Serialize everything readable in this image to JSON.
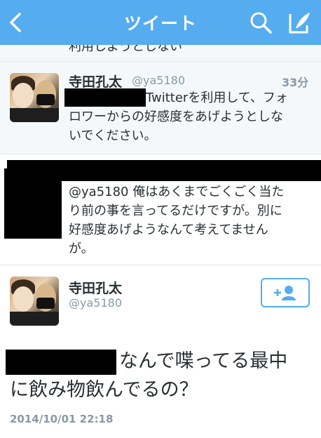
{
  "nav": {
    "title": "ツイート",
    "back_icon": "chevron-left-icon",
    "search_icon": "search-icon",
    "compose_icon": "compose-icon",
    "color": "#55acee"
  },
  "cut_tweet": {
    "text": "利用しようとしない"
  },
  "tweet1": {
    "name": "寺田孔太",
    "handle": "@ya5180",
    "time": "33分",
    "line1": "Twitterを利用して、フォ",
    "line2": "ロワーからの好感度をあげようとしな",
    "line3": "いでください。"
  },
  "tweet2": {
    "line1": "@ya5180 俺はあくまでごくごく当た",
    "line2": "り前の事を言ってるだけですが。別に",
    "line3": "好感度あげようなんて考えてません",
    "line4": "が。"
  },
  "main": {
    "name": "寺田孔太",
    "handle": "@ya5180",
    "follow_icon": "add-user-icon",
    "line1": "なんで喋ってる最中",
    "line2": "に飲み物飲んでるの？",
    "timestamp": "2014/10/01 22:18"
  }
}
